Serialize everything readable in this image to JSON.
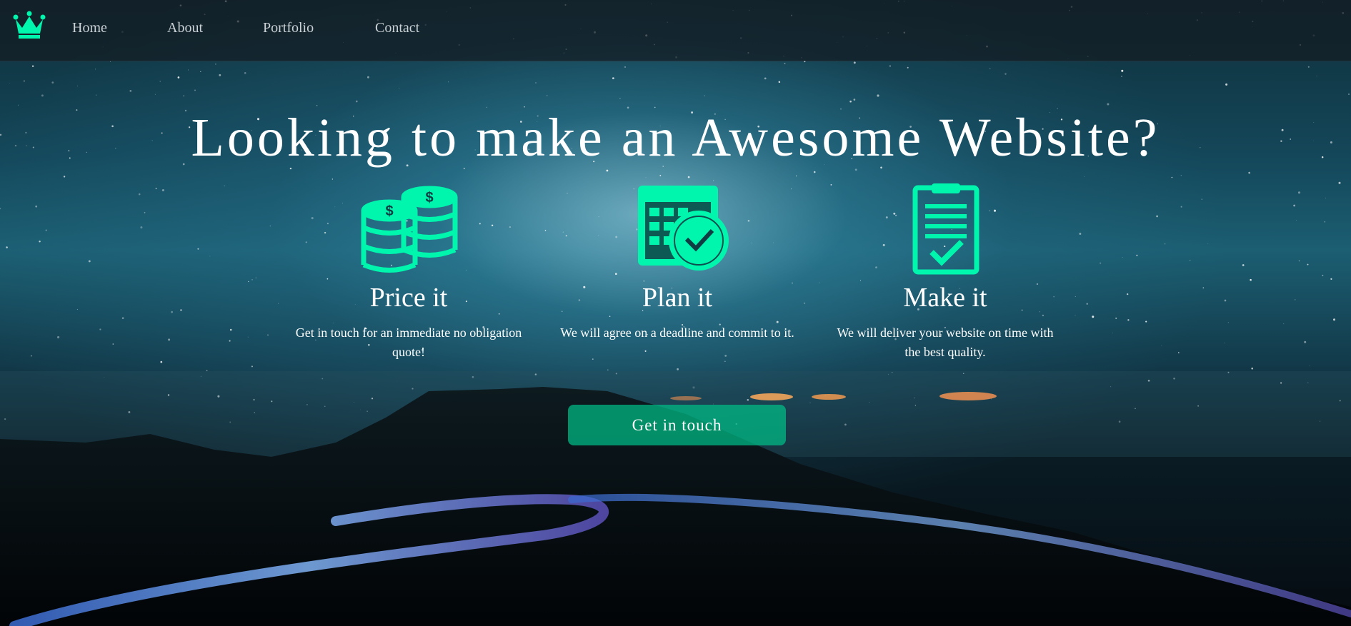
{
  "nav": {
    "logo_icon": "crown-icon",
    "links": [
      {
        "label": "Home"
      },
      {
        "label": "About"
      },
      {
        "label": "Portfolio"
      },
      {
        "label": "Contact"
      }
    ]
  },
  "hero": {
    "title": "Looking to make an Awesome Website?"
  },
  "features": [
    {
      "icon": "coins-icon",
      "title": "Price it",
      "text": "Get in touch for an immediate no obligation quote!"
    },
    {
      "icon": "calendar-clock-icon",
      "title": "Plan it",
      "text": "We will agree on a deadline and commit to it."
    },
    {
      "icon": "clipboard-check-icon",
      "title": "Make it",
      "text": "We will deliver your website on time with the best quality."
    }
  ],
  "cta": {
    "label": "Get in touch"
  },
  "colors": {
    "accent": "#00f5ad",
    "button": "#00be87",
    "nav_background": "#141c22",
    "text": "#ffffff",
    "nav_text": "#c9d1d4"
  }
}
